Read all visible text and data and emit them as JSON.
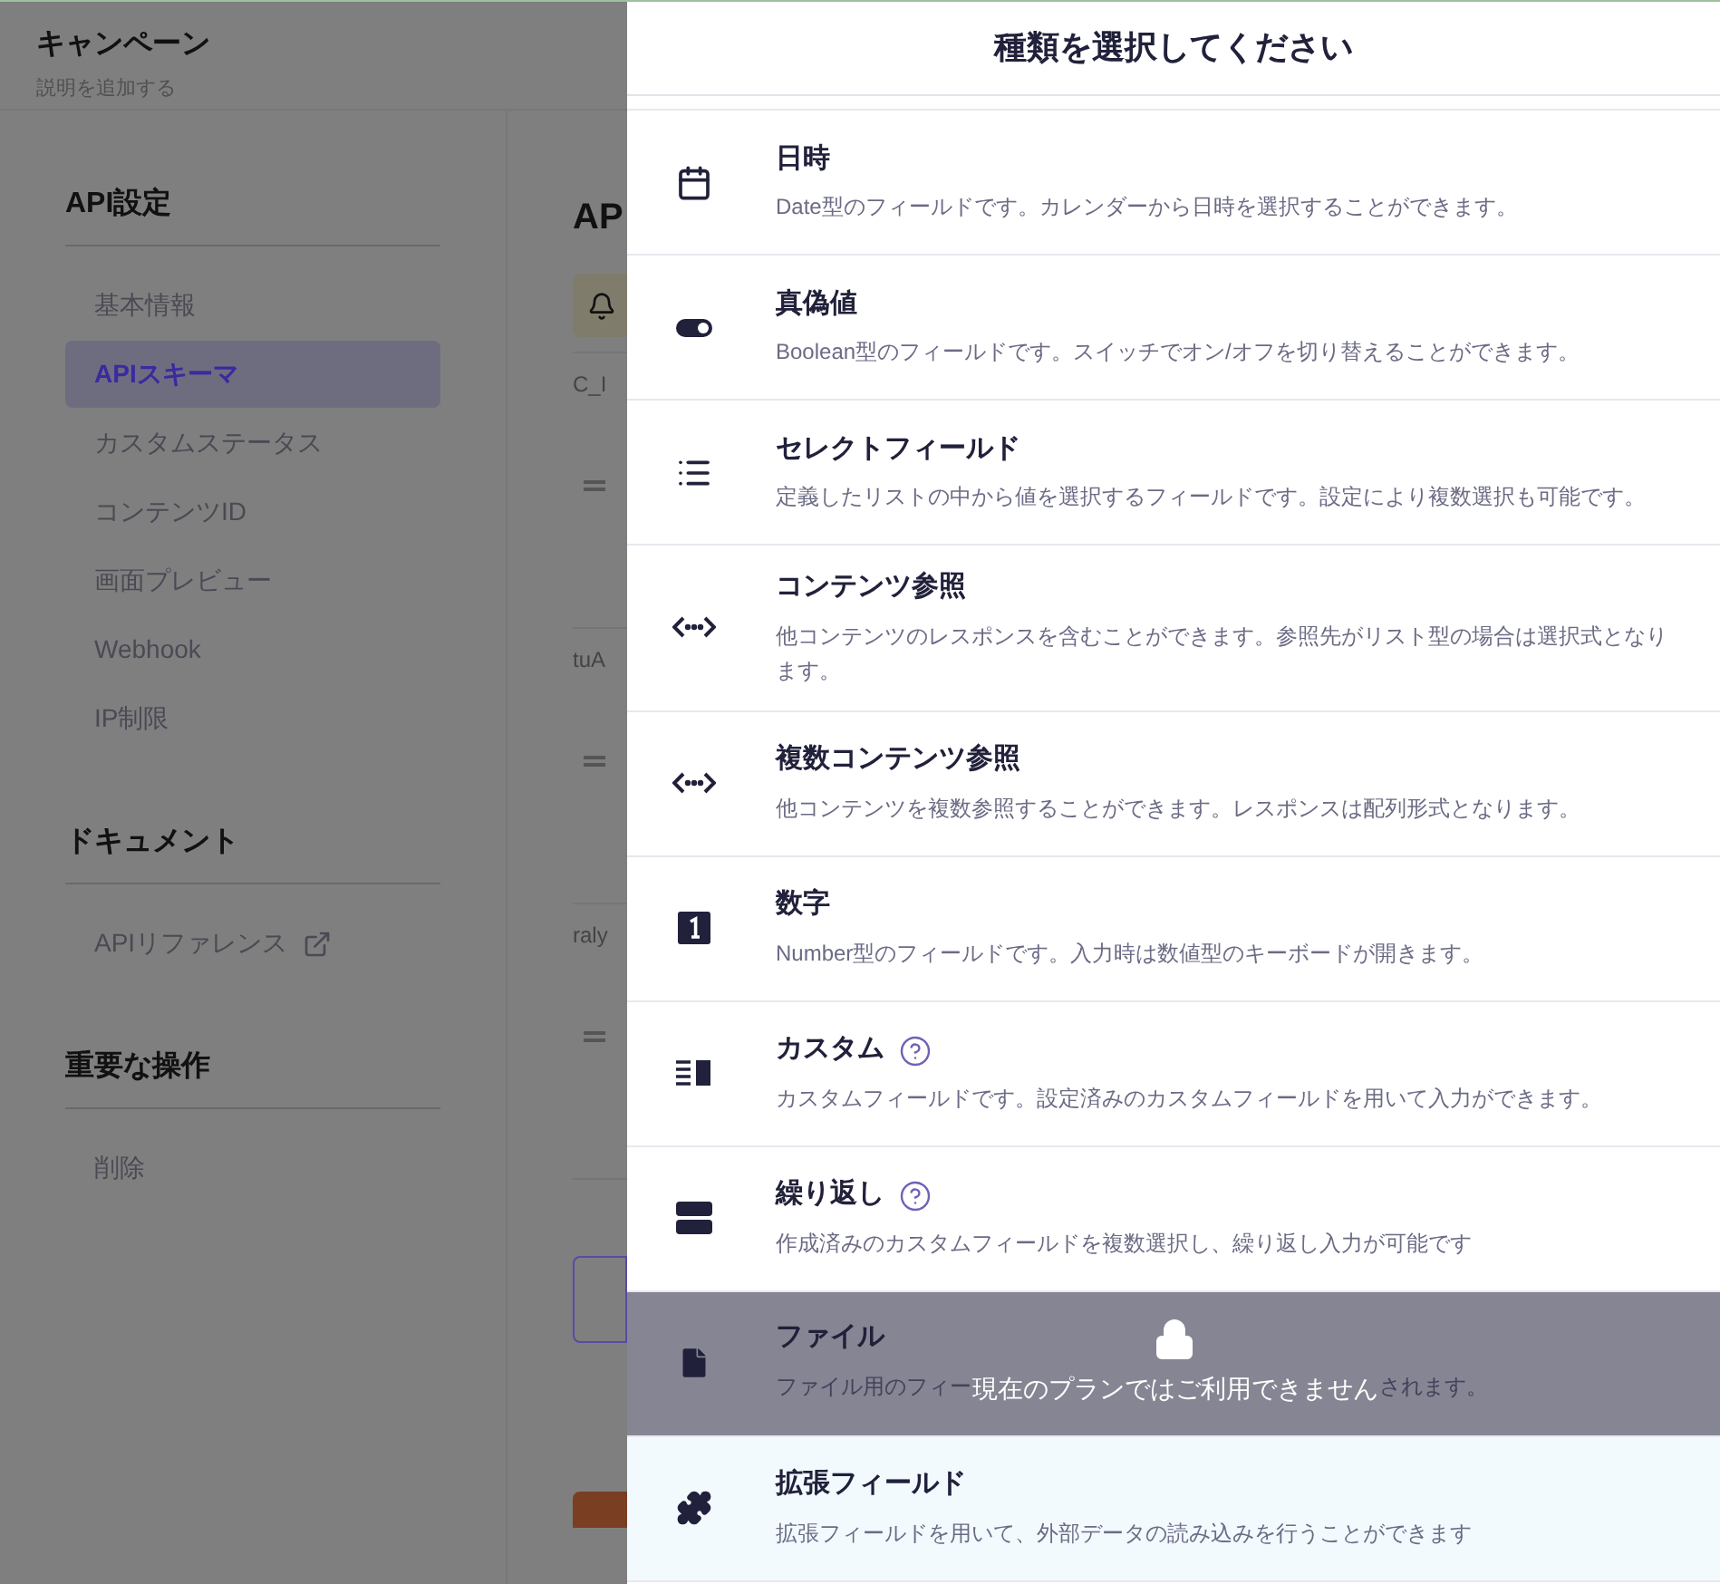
{
  "header": {
    "title": "キャンペーン",
    "subtitle": "説明を追加する"
  },
  "sidebar": {
    "sections": [
      {
        "title": "API設定",
        "items": [
          {
            "label": "基本情報",
            "selected": false
          },
          {
            "label": "APIスキーマ",
            "selected": true
          },
          {
            "label": "カスタムステータス",
            "selected": false
          },
          {
            "label": "コンテンツID",
            "selected": false
          },
          {
            "label": "画面プレビュー",
            "selected": false
          },
          {
            "label": "Webhook",
            "selected": false
          },
          {
            "label": "IP制限",
            "selected": false
          }
        ]
      },
      {
        "title": "ドキュメント",
        "items": [
          {
            "label": "APIリファレンス",
            "selected": false,
            "external": true
          }
        ]
      },
      {
        "title": "重要な操作",
        "items": [
          {
            "label": "削除",
            "selected": false
          }
        ]
      }
    ]
  },
  "main": {
    "heading": "AP",
    "fields": [
      {
        "name": "C_I"
      },
      {
        "name": "tuA"
      },
      {
        "name": "raly"
      }
    ]
  },
  "dialog": {
    "title": "種類を選択してください",
    "types": [
      {
        "kind": "date",
        "title": "日時",
        "description": "Date型のフィールドです。カレンダーから日時を選択することができます。",
        "help": false,
        "selected": false,
        "locked": false
      },
      {
        "kind": "boolean",
        "title": "真偽値",
        "description": "Boolean型のフィールドです。スイッチでオン/オフを切り替えることができます。",
        "help": false,
        "selected": false,
        "locked": false
      },
      {
        "kind": "select",
        "title": "セレクトフィールド",
        "description": "定義したリストの中から値を選択するフィールドです。設定により複数選択も可能です。",
        "help": false,
        "selected": false,
        "locked": false
      },
      {
        "kind": "relation",
        "title": "コンテンツ参照",
        "description": "他コンテンツのレスポンスを含むことができます。参照先がリスト型の場合は選択式となります。",
        "help": false,
        "selected": false,
        "locked": false
      },
      {
        "kind": "relation",
        "title": "複数コンテンツ参照",
        "description": "他コンテンツを複数参照することができます。レスポンスは配列形式となります。",
        "help": false,
        "selected": false,
        "locked": false
      },
      {
        "kind": "number",
        "title": "数字",
        "description": "Number型のフィールドです。入力時は数値型のキーボードが開きます。",
        "help": false,
        "selected": false,
        "locked": false
      },
      {
        "kind": "custom",
        "title": "カスタム",
        "description": "カスタムフィールドです。設定済みのカスタムフィールドを用いて入力ができます。",
        "help": true,
        "selected": false,
        "locked": false
      },
      {
        "kind": "repeat",
        "title": "繰り返し",
        "description": "作成済みのカスタムフィールドを複数選択し、繰り返し入力が可能です",
        "help": true,
        "selected": false,
        "locked": false
      },
      {
        "kind": "file",
        "title": "ファイル",
        "description_parts": [
          "ファイル用のフィー",
          "されます。"
        ],
        "help": false,
        "locked": true,
        "lock_message": "現在のプランではご利用できません"
      },
      {
        "kind": "extension",
        "title": "拡張フィールド",
        "description": "拡張フィールドを用いて、外部データの読み込みを行うことができます",
        "help": false,
        "selected": true,
        "locked": false
      }
    ]
  }
}
